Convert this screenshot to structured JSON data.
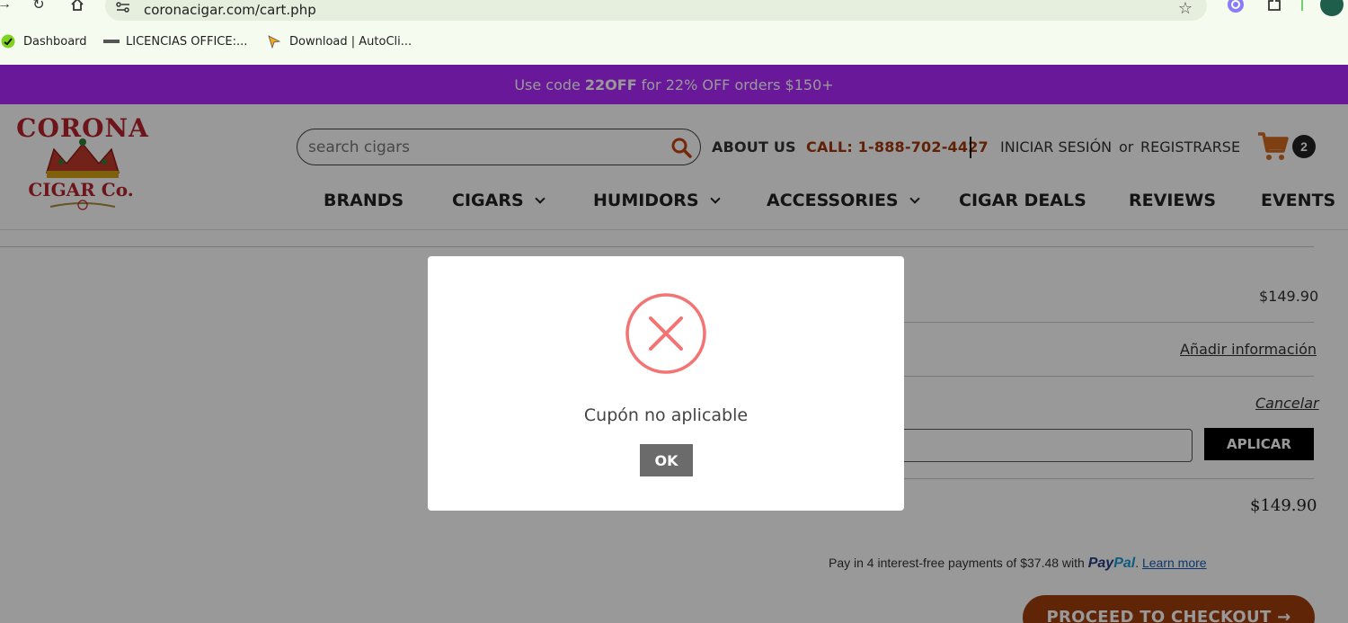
{
  "browser": {
    "url": "coronacigar.com/cart.php",
    "bookmarks": [
      {
        "label": "Dashboard",
        "icon": "dashboard-favicon"
      },
      {
        "label": "LICENCIAS OFFICE:...",
        "icon": "licencias-favicon"
      },
      {
        "label": "Download | AutoCli...",
        "icon": "autocli-favicon"
      }
    ],
    "accent": "#e6eedd"
  },
  "promo": {
    "prefix": "Use code",
    "code": "22OFF",
    "suffix": "for 22% OFF orders $150+",
    "color": "#ad29ff"
  },
  "header": {
    "logo_alt": "Corona Cigar Co.",
    "search_placeholder": "search cigars",
    "about": "ABOUT US",
    "call": "CALL: 1-888-702-4427",
    "login": "INICIAR SESIÓN",
    "or": "or",
    "register": "REGISTRARSE",
    "cart_count": "2",
    "nav": [
      {
        "label": "BRANDS",
        "dropdown": false
      },
      {
        "label": "CIGARS",
        "dropdown": true
      },
      {
        "label": "HUMIDORS",
        "dropdown": true
      },
      {
        "label": "ACCESSORIES",
        "dropdown": true
      },
      {
        "label": "CIGAR DEALS",
        "dropdown": false
      },
      {
        "label": "REVIEWS",
        "dropdown": false
      },
      {
        "label": "EVENTS",
        "dropdown": false
      }
    ]
  },
  "cart_summary": {
    "subtotal": "$149.90",
    "add_info": "Añadir información",
    "cancel": "Cancelar",
    "apply": "APLICAR",
    "total": "$149.90",
    "paypal": {
      "text": "Pay in 4 interest-free payments of $37.48 with",
      "brand_pay": "Pay",
      "brand_pal": "Pal",
      "learn_more": "Learn more"
    },
    "checkout": "PROCEED TO CHECKOUT →",
    "checkout_color": "#a13f0c"
  },
  "modal": {
    "message": "Cupón no aplicable",
    "ok": "OK",
    "icon": "error-x-icon",
    "icon_color": "#f27474"
  }
}
